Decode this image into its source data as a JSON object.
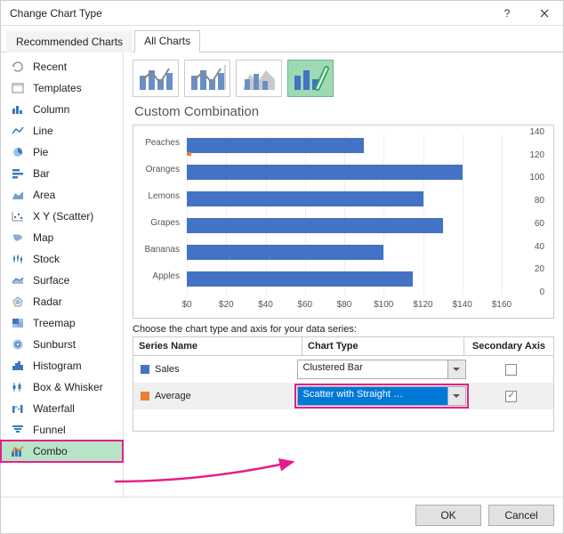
{
  "window": {
    "title": "Change Chart Type"
  },
  "tabs": {
    "recommended": "Recommended Charts",
    "all": "All Charts"
  },
  "sidebar": {
    "items": [
      {
        "label": "Recent"
      },
      {
        "label": "Templates"
      },
      {
        "label": "Column"
      },
      {
        "label": "Line"
      },
      {
        "label": "Pie"
      },
      {
        "label": "Bar"
      },
      {
        "label": "Area"
      },
      {
        "label": "X Y (Scatter)"
      },
      {
        "label": "Map"
      },
      {
        "label": "Stock"
      },
      {
        "label": "Surface"
      },
      {
        "label": "Radar"
      },
      {
        "label": "Treemap"
      },
      {
        "label": "Sunburst"
      },
      {
        "label": "Histogram"
      },
      {
        "label": "Box & Whisker"
      },
      {
        "label": "Waterfall"
      },
      {
        "label": "Funnel"
      },
      {
        "label": "Combo"
      }
    ]
  },
  "main": {
    "title": "Custom Combination",
    "instruction": "Choose the chart type and axis for your data series:"
  },
  "seriesTable": {
    "headers": {
      "name": "Series Name",
      "type": "Chart Type",
      "sec": "Secondary Axis"
    },
    "rows": [
      {
        "swatch": "#4472c4",
        "name": "Sales",
        "type": "Clustered Bar",
        "secondary": false
      },
      {
        "swatch": "#ed7d31",
        "name": "Average",
        "type": "Scatter with Straight …",
        "secondary": true
      }
    ]
  },
  "footer": {
    "ok": "OK",
    "cancel": "Cancel"
  },
  "chart_data": {
    "type": "bar",
    "orientation": "horizontal",
    "categories": [
      "Peaches",
      "Oranges",
      "Lemons",
      "Grapes",
      "Bananas",
      "Apples"
    ],
    "values": [
      90,
      140,
      120,
      130,
      100,
      115
    ],
    "xlabel": "",
    "ylabel": "",
    "xlim": [
      0,
      160
    ],
    "xticks": [
      "$0",
      "$20",
      "$40",
      "$60",
      "$80",
      "$100",
      "$120",
      "$140",
      "$160"
    ],
    "secondary_axis": {
      "range": [
        0,
        140
      ],
      "ticks": [
        0,
        20,
        40,
        60,
        80,
        100,
        120,
        140
      ]
    },
    "title": ""
  }
}
